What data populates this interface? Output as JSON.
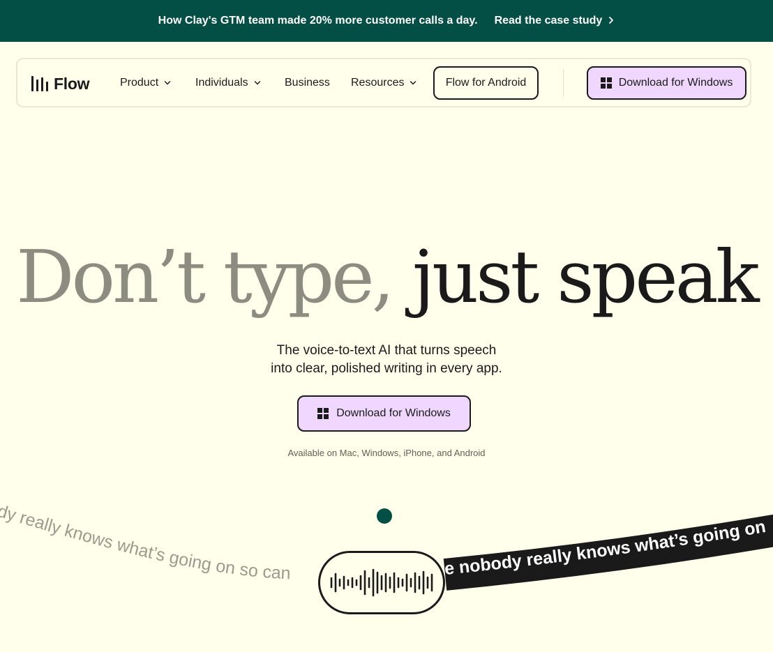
{
  "banner": {
    "message": "How Clay's GTM team made 20% more customer calls a day.",
    "cta_label": "Read the case study",
    "cta_icon": "chevron-right-icon"
  },
  "nav": {
    "logo_text": "Flow",
    "logo_icon": "waveform-bars-icon",
    "links": [
      {
        "label": "Product",
        "has_dropdown": true
      },
      {
        "label": "Individuals",
        "has_dropdown": true
      },
      {
        "label": "Business",
        "has_dropdown": false
      },
      {
        "label": "Resources",
        "has_dropdown": true
      }
    ],
    "android_button": "Flow for Android",
    "download_button": "Download for Windows",
    "download_icon": "windows-logo-icon"
  },
  "hero": {
    "title_light": "Don’t type,",
    "title_dark": "just speak",
    "subtitle_line1": "The voice-to-text AI that turns speech",
    "subtitle_line2": "into clear, polished writing in every app.",
    "cta_label": "Download for Windows",
    "availability": "Available on Mac, Windows, iPhone, and Android"
  },
  "demo": {
    "spoken_text": "dy really knows what’s going on so can",
    "transcribed_text": "e nobody really knows what’s going on",
    "mic_icon": "audio-waveform-icon"
  },
  "colors": {
    "background": "#FFFFEB",
    "banner": "#034F46",
    "accent_purple": "#F0D7FF",
    "ink": "#1A1A1A",
    "muted": "#8C8C80"
  }
}
